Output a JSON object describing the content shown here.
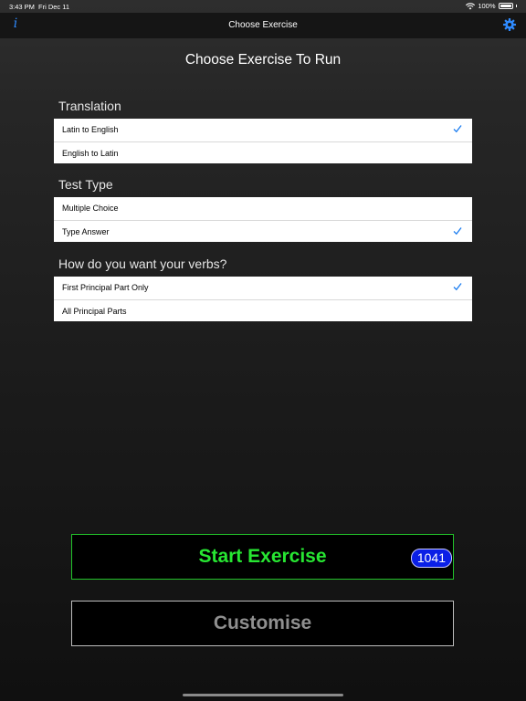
{
  "status_bar": {
    "time": "3:43 PM",
    "date": "Fri Dec 11",
    "battery": "100%"
  },
  "nav": {
    "title": "Choose Exercise",
    "info_glyph": "i",
    "settings_icon": "gear-icon"
  },
  "heading": "Choose Exercise To Run",
  "sections": [
    {
      "title": "Translation",
      "items": [
        {
          "label": "Latin to English",
          "checked": true
        },
        {
          "label": "English to Latin",
          "checked": false
        }
      ]
    },
    {
      "title": "Test Type",
      "items": [
        {
          "label": "Multiple Choice",
          "checked": false
        },
        {
          "label": "Type Answer",
          "checked": true
        }
      ]
    },
    {
      "title": "How do you want your verbs?",
      "items": [
        {
          "label": "First Principal Part Only",
          "checked": true
        },
        {
          "label": "All Principal Parts",
          "checked": false
        }
      ]
    }
  ],
  "buttons": {
    "start_label": "Start Exercise",
    "start_count": "1041",
    "customise_label": "Customise"
  },
  "colors": {
    "accent": "#2f8bff",
    "start_green": "#27e632",
    "badge_blue": "#0a1fe6",
    "checkmark": "#1a7cf0"
  }
}
